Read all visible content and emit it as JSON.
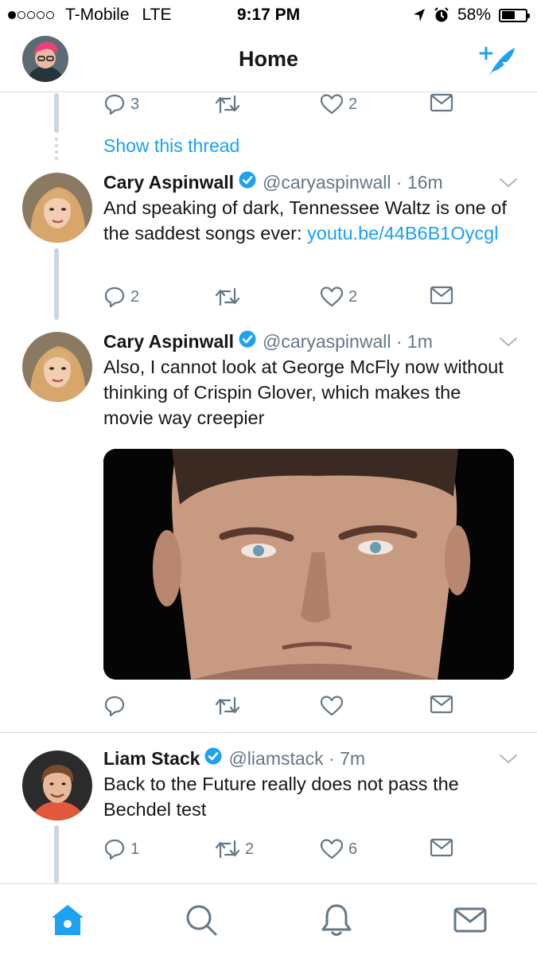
{
  "status_bar": {
    "carrier": "T-Mobile",
    "network": "LTE",
    "time": "9:17 PM",
    "battery": "58%",
    "battery_level": 0.58
  },
  "header": {
    "title": "Home"
  },
  "colors": {
    "accent": "#1da1f2",
    "muted": "#657786",
    "text": "#14171a",
    "divider": "#d5d9dd"
  },
  "feed": {
    "top_actions": {
      "reply_count": "3",
      "retweet_count": "",
      "like_count": "2"
    },
    "show_thread": "Show this thread",
    "tweets": [
      {
        "name": "Cary Aspinwall",
        "handle": "@caryaspinwall",
        "time": "16m",
        "text": "And speaking of dark, Tennessee Waltz is one of the saddest songs ever: ",
        "link": "youtu.be/44B6B1Oycgl",
        "reply_count": "2",
        "retweet_count": "",
        "like_count": "2"
      },
      {
        "name": "Cary Aspinwall",
        "handle": "@caryaspinwall",
        "time": "1m",
        "text": "Also, I cannot look at George McFly now without thinking of Crispin Glover, which makes the movie way creepier",
        "reply_count": "",
        "retweet_count": "",
        "like_count": ""
      },
      {
        "name": "Liam Stack",
        "handle": "@liamstack",
        "time": "7m",
        "text": "Back to the Future really does not pass the Bechdel test",
        "reply_count": "1",
        "retweet_count": "2",
        "like_count": "6"
      }
    ]
  },
  "tabbar": {
    "icons": [
      "home-icon",
      "search-icon",
      "notifications-icon",
      "messages-icon"
    ]
  }
}
